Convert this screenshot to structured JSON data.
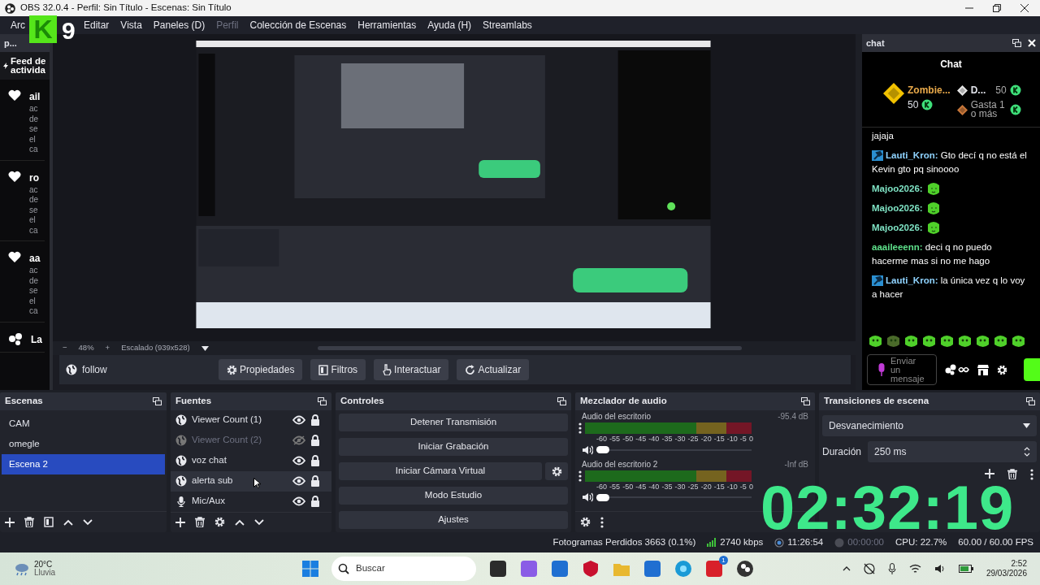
{
  "window": {
    "title": "OBS 32.0.4 - Perfil: Sin Título - Escenas: Sin Título"
  },
  "menu": [
    {
      "label": "Arc",
      "disabled": false
    },
    {
      "label": "Editar",
      "disabled": false
    },
    {
      "label": "Vista",
      "disabled": false
    },
    {
      "label": "Paneles (D)",
      "disabled": false
    },
    {
      "label": "Perfil",
      "disabled": true
    },
    {
      "label": "Colección de Escenas",
      "disabled": false
    },
    {
      "label": "Herramientas",
      "disabled": false
    },
    {
      "label": "Ayuda (H)",
      "disabled": false
    },
    {
      "label": "Streamlabs",
      "disabled": false
    }
  ],
  "overlay_logo": {
    "mark": "K",
    "digit": "9"
  },
  "activity_dock": {
    "title": "p...",
    "heading": "Feed de activida",
    "events": [
      {
        "kind": "follow",
        "name": "ail",
        "detail": [
          "ac",
          "de",
          "se",
          "el",
          "ca"
        ]
      },
      {
        "kind": "follow",
        "name": "ro",
        "detail": [
          "ac",
          "de",
          "se",
          "el",
          "ca"
        ]
      },
      {
        "kind": "follow",
        "name": "aa",
        "detail": [
          "ac",
          "de",
          "se",
          "el",
          "ca"
        ]
      },
      {
        "kind": "raid",
        "name": "La"
      }
    ]
  },
  "preview": {
    "zoom_out": "−",
    "zoom": "48%",
    "zoom_in": "+",
    "scale": "Escalado (939x528)"
  },
  "source_toolbar": {
    "source": "follow",
    "buttons": [
      {
        "kind": "gear",
        "label": "Propiedades"
      },
      {
        "kind": "filter",
        "label": "Filtros"
      },
      {
        "kind": "hand",
        "label": "Interactuar"
      },
      {
        "kind": "refresh",
        "label": "Actualizar"
      }
    ]
  },
  "chat": {
    "dock_title": "chat",
    "title": "Chat",
    "leaders": [
      {
        "name": "Zombie...",
        "points": "50",
        "color": "#f2c200"
      },
      {
        "name": "D...",
        "points": "50",
        "color": "#e6e6e6"
      },
      {
        "name": "Gasta 1 o más",
        "color": "#c8773a"
      }
    ],
    "messages": [
      {
        "kind": "continuation",
        "text": "jajaja"
      },
      {
        "kind": "text",
        "user": "Lauti_Kron:",
        "color": "#8fd3ff",
        "badge": true,
        "text": "Gto decí q no está el Kevin gto pq sinoooo"
      },
      {
        "kind": "emote",
        "user": "Majoo2026:",
        "color": "#7fe3c4"
      },
      {
        "kind": "emote",
        "user": "Majoo2026:",
        "color": "#7fe3c4"
      },
      {
        "kind": "emote",
        "user": "Majoo2026:",
        "color": "#7fe3c4"
      },
      {
        "kind": "text",
        "user": "aaaileeenn:",
        "color": "#5ee08a",
        "text": "deci q no puedo hacerme mas si no me hago"
      },
      {
        "kind": "text",
        "user": "Lauti_Kron:",
        "color": "#8fd3ff",
        "badge": true,
        "text": "la única vez q lo voy a hacer"
      }
    ],
    "input": {
      "placeholder": "Enviar un mensaje"
    }
  },
  "scenes": {
    "title": "Escenas",
    "items": [
      {
        "label": "CAM",
        "selected": false
      },
      {
        "label": "omegle",
        "selected": false
      },
      {
        "label": "Escena 2",
        "selected": true
      }
    ]
  },
  "sources": {
    "title": "Fuentes",
    "items": [
      {
        "kind": "browser",
        "label": "Viewer Count (1)",
        "visible": true,
        "locked": true,
        "highlighted": false
      },
      {
        "kind": "browser",
        "label": "Viewer Count (2)",
        "visible": false,
        "locked": true,
        "highlighted": false
      },
      {
        "kind": "browser",
        "label": "voz chat",
        "visible": true,
        "locked": true,
        "highlighted": false
      },
      {
        "kind": "browser",
        "label": "alerta sub",
        "visible": true,
        "locked": true,
        "highlighted": true
      },
      {
        "kind": "mic",
        "label": "Mic/Aux",
        "visible": true,
        "locked": true,
        "highlighted": false
      }
    ]
  },
  "controls": {
    "title": "Controles",
    "buttons": [
      {
        "label": "Detener Transmisión",
        "settings": false
      },
      {
        "label": "Iniciar Grabación",
        "settings": false
      },
      {
        "label": "Iniciar Cámara Virtual",
        "settings": true
      },
      {
        "label": "Modo Estudio",
        "settings": false
      },
      {
        "label": "Ajustes",
        "settings": false
      }
    ]
  },
  "mixer": {
    "title": "Mezclador de audio",
    "channels": [
      {
        "name": "Audio del escritorio",
        "reading": "-95.4 dB",
        "volume": {
          "level": 0
        },
        "scale": [
          "-60",
          "-55",
          "-50",
          "-45",
          "-40",
          "-35",
          "-30",
          "-25",
          "-20",
          "-15",
          "-10",
          "-5",
          "0"
        ]
      },
      {
        "name": "Audio del escritorio 2",
        "reading": "-Inf dB",
        "volume": {
          "level": 0
        },
        "scale": [
          "-60",
          "-55",
          "-50",
          "-45",
          "-40",
          "-35",
          "-30",
          "-25",
          "-20",
          "-15",
          "-10",
          "-5",
          "0"
        ]
      }
    ]
  },
  "transitions": {
    "title": "Transiciones de escena",
    "transition": "Desvanecimiento",
    "duration_label": "Duración",
    "duration": "250 ms"
  },
  "status_bar": {
    "dropped": "Fotogramas Perdidos 3663 (0.1%)",
    "bitrate": "2740 kbps",
    "stream_time": "11:26:54",
    "record_time": "00:00:00",
    "cpu": "CPU: 22.7%",
    "fps": "60.00 / 60.00 FPS"
  },
  "timer_overlay": "02:32:19",
  "taskbar": {
    "temperature": "20°C",
    "weather": "Lluvia",
    "search_placeholder": "Buscar",
    "app_badge": "1",
    "time": "2:52",
    "date": "29/03/2026"
  }
}
